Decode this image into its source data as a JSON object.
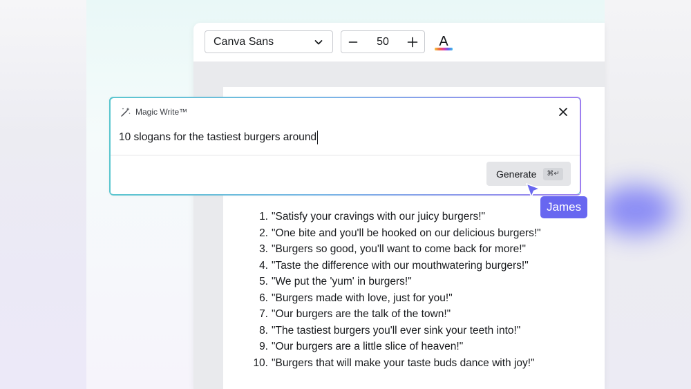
{
  "toolbar": {
    "font_name": "Canva Sans",
    "font_size": "50",
    "decrease_symbol": "−",
    "increase_symbol": "+",
    "text_color_icon": "A"
  },
  "magic_write": {
    "title": "Magic Write™",
    "prompt": "10 slogans for the tastiest burgers around",
    "generate_label": "Generate",
    "shortcut": "⌘↵"
  },
  "collaborator": {
    "name": "James",
    "color": "#6867f0"
  },
  "slogans": [
    {
      "num": "1.",
      "text": "\"Satisfy your cravings with our juicy burgers!\""
    },
    {
      "num": "2.",
      "text": "\"One bite and you'll be hooked on our delicious burgers!\""
    },
    {
      "num": "3.",
      "text": "\"Burgers so good, you'll want to come back for more!\""
    },
    {
      "num": "4.",
      "text": "\"Taste the difference with our mouthwatering burgers!\""
    },
    {
      "num": "5.",
      "text": "\"We put the 'yum' in burgers!\""
    },
    {
      "num": "6.",
      "text": "\"Burgers made with love, just for you!\""
    },
    {
      "num": "7.",
      "text": "\"Our burgers are the talk of the town!\""
    },
    {
      "num": "8.",
      "text": "\"The tastiest burgers you'll ever sink your teeth into!\""
    },
    {
      "num": "9.",
      "text": "\"Our burgers are a little slice of heaven!\""
    },
    {
      "num": "10.",
      "text": "\"Burgers that will make your taste buds dance with joy!\""
    }
  ],
  "icons": {
    "magic": "magic-wand-icon",
    "close": "close-icon",
    "dropdown": "chevron-down-icon",
    "text_color": "text-color-icon",
    "cursor": "pointer-cursor-icon"
  }
}
